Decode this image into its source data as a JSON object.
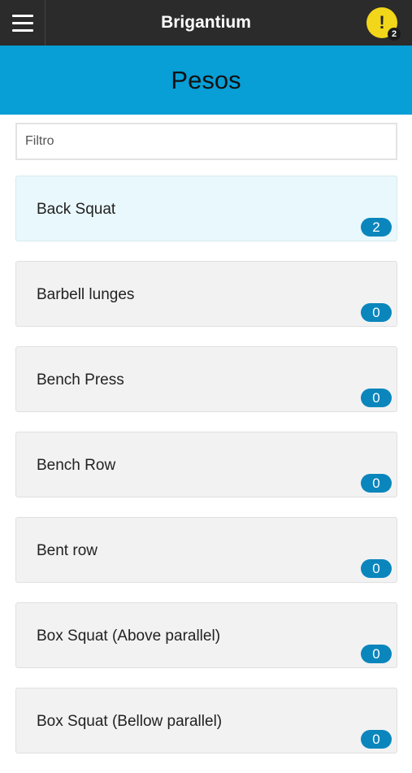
{
  "topbar": {
    "app_title": "Brigantium",
    "menu_icon": "hamburger-menu-icon",
    "alert_icon": "exclamation-alert-icon",
    "alert_symbol": "!",
    "alert_count": "2"
  },
  "header": {
    "title": "Pesos",
    "background_color": "#089ed6"
  },
  "filter": {
    "placeholder": "Filtro",
    "value": ""
  },
  "exercises": [
    {
      "label": "Back Squat",
      "count": "2"
    },
    {
      "label": "Barbell lunges",
      "count": "0"
    },
    {
      "label": "Bench Press",
      "count": "0"
    },
    {
      "label": "Bench Row",
      "count": "0"
    },
    {
      "label": "Bent row",
      "count": "0"
    },
    {
      "label": "Box Squat (Above parallel)",
      "count": "0"
    },
    {
      "label": "Box Squat (Bellow parallel)",
      "count": "0"
    }
  ],
  "colors": {
    "topbar": "#2b2b2b",
    "badge": "#0a86bd",
    "alert": "#f2d61a",
    "active_item": "#e9f8fd"
  }
}
